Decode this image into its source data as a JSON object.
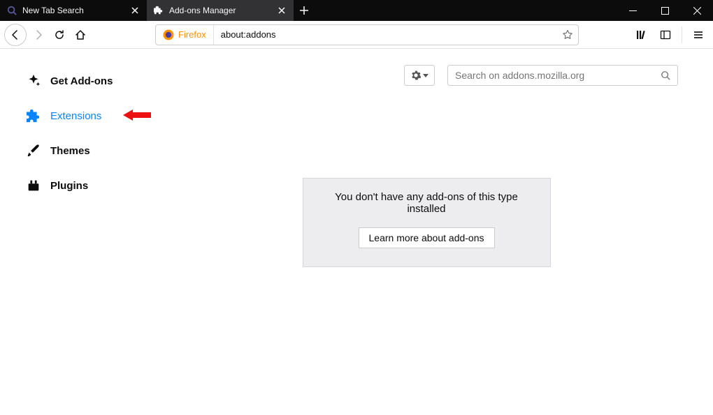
{
  "tabs": [
    {
      "label": "New Tab Search",
      "active": false
    },
    {
      "label": "Add-ons Manager",
      "active": true
    }
  ],
  "urlbar": {
    "identity_label": "Firefox",
    "value": "about:addons"
  },
  "sidebar": {
    "items": [
      {
        "label": "Get Add-ons"
      },
      {
        "label": "Extensions"
      },
      {
        "label": "Themes"
      },
      {
        "label": "Plugins"
      }
    ]
  },
  "search": {
    "placeholder": "Search on addons.mozilla.org"
  },
  "empty": {
    "message": "You don't have any add-ons of this type installed",
    "button": "Learn more about add-ons"
  }
}
